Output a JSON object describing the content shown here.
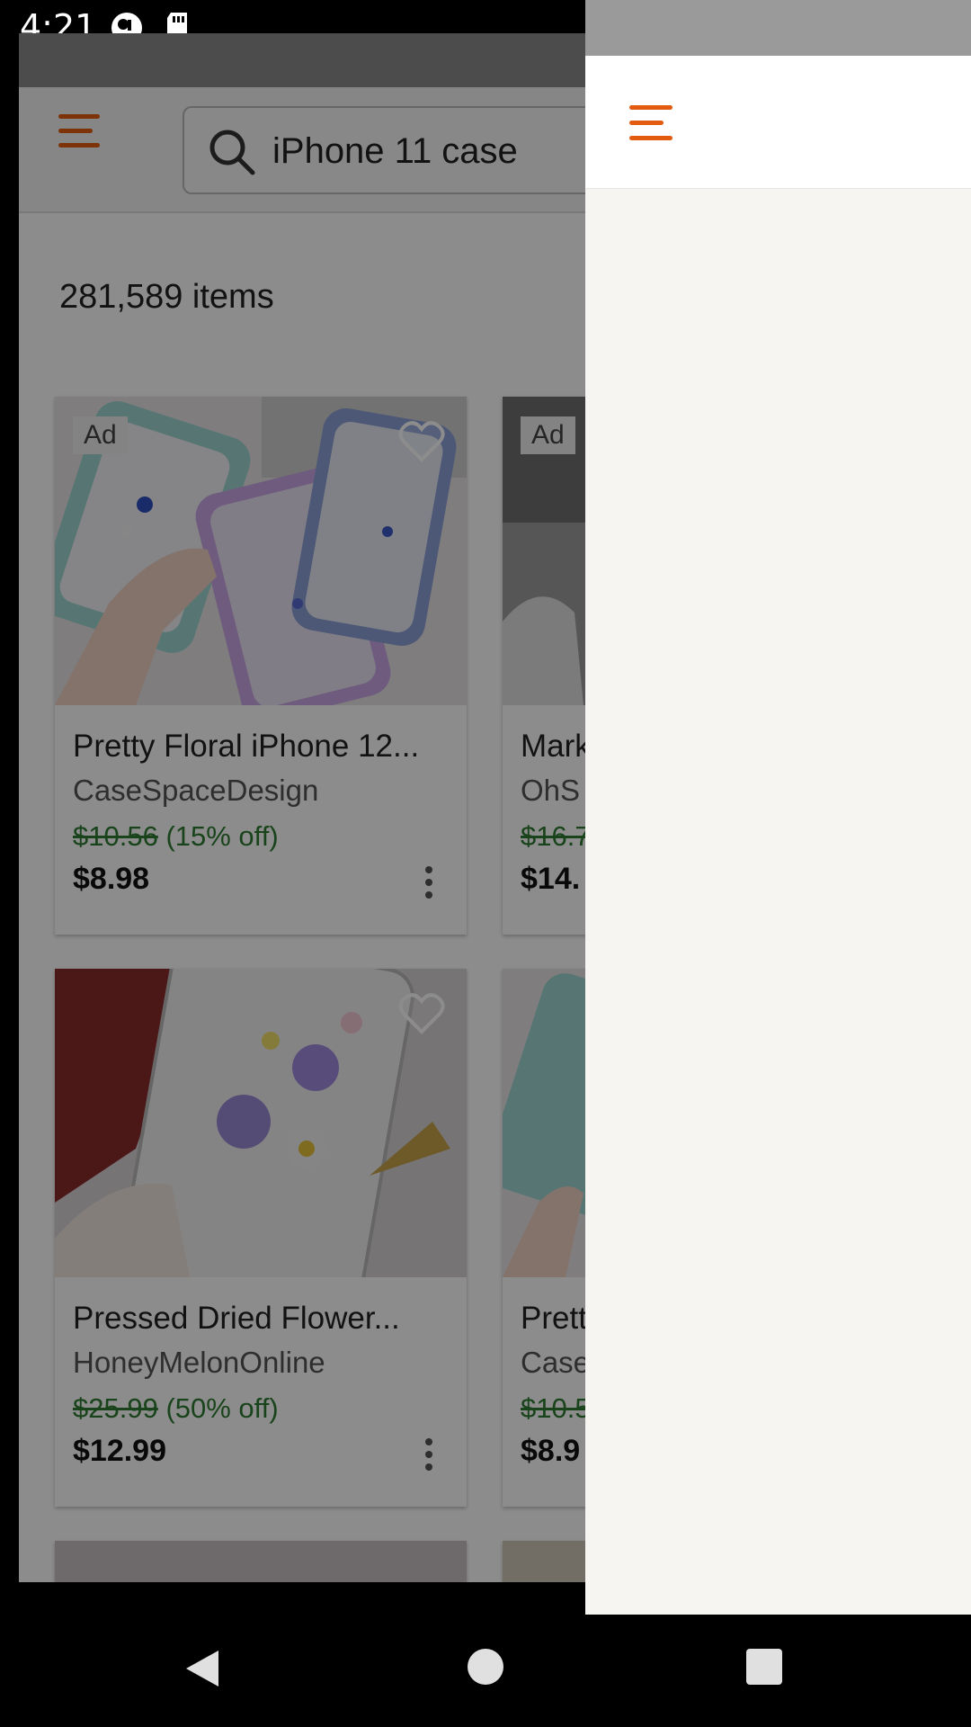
{
  "status_bar": {
    "time": "4:21"
  },
  "search": {
    "query": "iPhone 11 case"
  },
  "results": {
    "count": "281,589 items"
  },
  "products": [
    {
      "title": "Pretty Floral iPhone 12...",
      "shop": "CaseSpaceDesign",
      "original_price": "$10.56",
      "discount": "(15% off)",
      "price": "$8.98",
      "ad": "Ad"
    },
    {
      "title": "Mark",
      "shop": "OhS",
      "original_price": "$16.7",
      "discount": "",
      "price": "$14.",
      "ad": "Ad"
    },
    {
      "title": "Pressed Dried Flower...",
      "shop": "HoneyMelonOnline",
      "original_price": "$25.99",
      "discount": "(50% off)",
      "price": "$12.99",
      "ad": ""
    },
    {
      "title": "Prett",
      "shop": "Case",
      "original_price": "$10.5",
      "discount": "",
      "price": "$8.9",
      "ad": ""
    }
  ],
  "colors": {
    "accent": "#e35b0f",
    "discount_green": "#2e7d32"
  }
}
